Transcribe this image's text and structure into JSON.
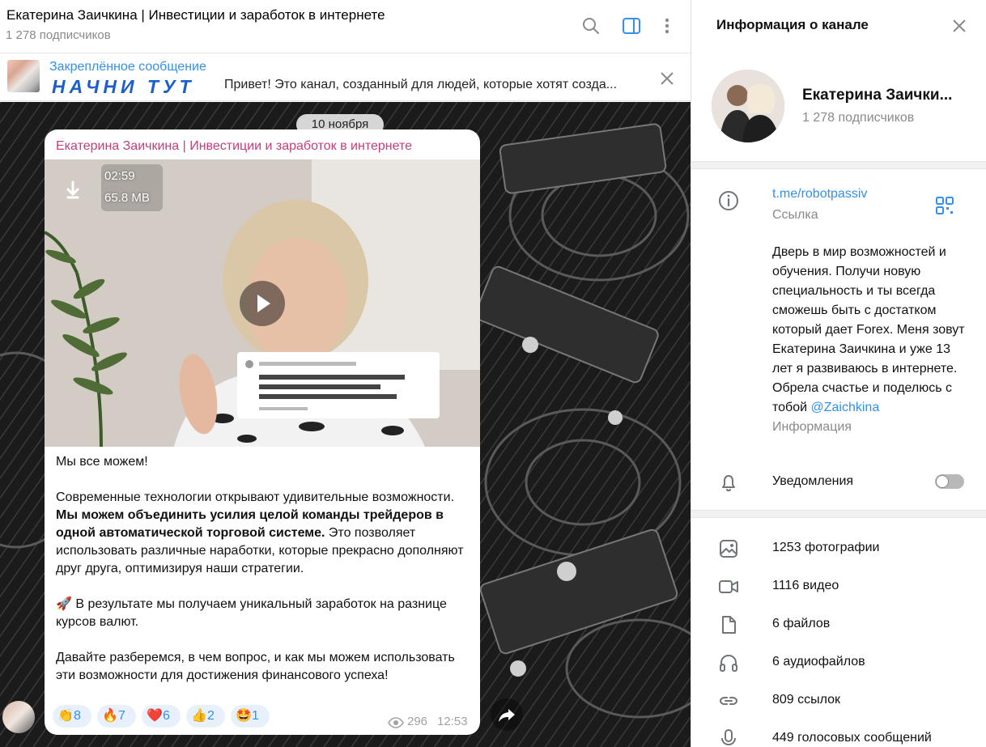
{
  "chat": {
    "title": "Екатерина Заичкина | Инвестиции и заработок в интернете",
    "subscribers": "1 278 подписчиков",
    "icons": [
      "search-icon",
      "sidebar-toggle-icon",
      "more-vertical-icon"
    ]
  },
  "pinned": {
    "label": "Закреплённое сообщение",
    "headline": "НАЧНИ ТУТ",
    "text": "Привет! Это канал, созданный для людей, которые хотят созда..."
  },
  "date_divider": "10 ноября",
  "message": {
    "author": "Екатерина Заичкина | Инвестиции и заработок в интернете",
    "video": {
      "duration": "02:59",
      "size": "65.8 MB"
    },
    "p1": "Мы все можем!",
    "p2_start": "Современные технологии открывают удивительные возможности. ",
    "p2_bold": "Мы можем объединить усилия целой команды трейдеров в одной автоматической торговой системе.",
    "p2_end": " Это позволяет использовать различные наработки, которые прекрасно дополняют друг друга, оптимизируя наши стратегии.",
    "p3": "🚀 В результате мы получаем уникальный заработок на разнице курсов валют.",
    "p4": "Давайте разберемся, в чем вопрос, и как мы можем использовать эти возможности для достижения финансового успеха!",
    "reactions": [
      {
        "emoji": "👏",
        "count": "8"
      },
      {
        "emoji": "🔥",
        "count": "7"
      },
      {
        "emoji": "❤️",
        "count": "6"
      },
      {
        "emoji": "👍",
        "count": "2"
      },
      {
        "emoji": "🤩",
        "count": "1"
      }
    ],
    "views": "296",
    "time": "12:53"
  },
  "panel": {
    "title": "Информация о канале",
    "name": "Екатерина Заички...",
    "subscribers": "1 278 подписчиков",
    "link": "t.me/robotpassiv",
    "link_caption": "Ссылка",
    "description": "Дверь в мир возможностей и обучения. Получи новую специальность и ты всегда сможешь быть с достатком который дает Forex. Меня зовут Екатерина Заичкина и уже 13 лет я развиваюсь в интернете. Обрела счастье и поделюсь с тобой ",
    "description_mention": "@Zaichkina",
    "description_caption": "Информация",
    "notifications": "Уведомления",
    "notifications_on": false,
    "media": {
      "photos": "1253 фотографии",
      "videos": "1116 видео",
      "files": "6 файлов",
      "audio": "6 аудиофайлов",
      "links": "809 ссылок",
      "voice": "449 голосовых сообщений"
    }
  }
}
